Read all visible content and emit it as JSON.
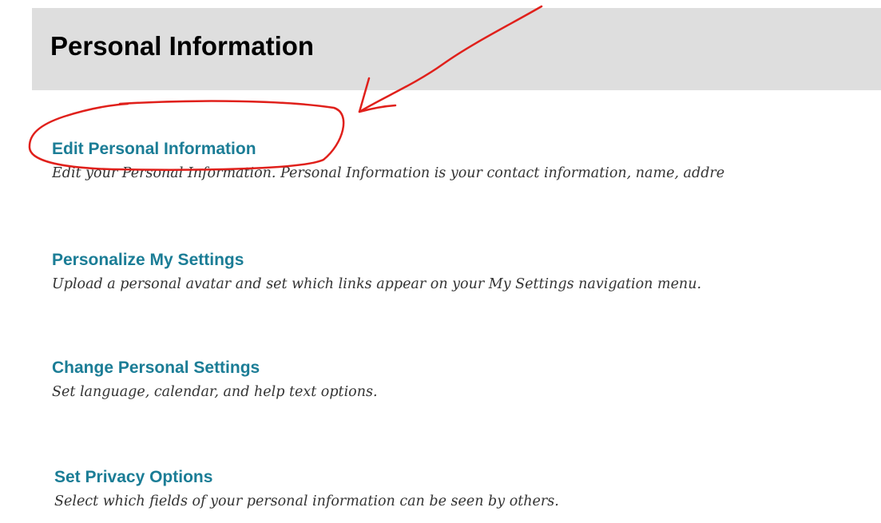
{
  "header": {
    "title": "Personal Information"
  },
  "options": [
    {
      "label": "Edit Personal Information",
      "description": "Edit your Personal Information. Personal Information is your contact information, name, addre"
    },
    {
      "label": "Personalize My Settings",
      "description": "Upload a personal avatar and set which links appear on your My Settings navigation menu."
    },
    {
      "label": "Change Personal Settings",
      "description": "Set language, calendar, and help text options."
    },
    {
      "label": "Set Privacy Options",
      "description": "Select which fields of your personal information can be seen by others."
    }
  ],
  "colors": {
    "header_background": "#dedede",
    "link": "#1b7d96",
    "description_text": "#333333",
    "annotation": "#e0201b"
  },
  "annotation": {
    "type": "hand-drawn red arrow pointing to a circled link",
    "target": "Edit Personal Information"
  }
}
